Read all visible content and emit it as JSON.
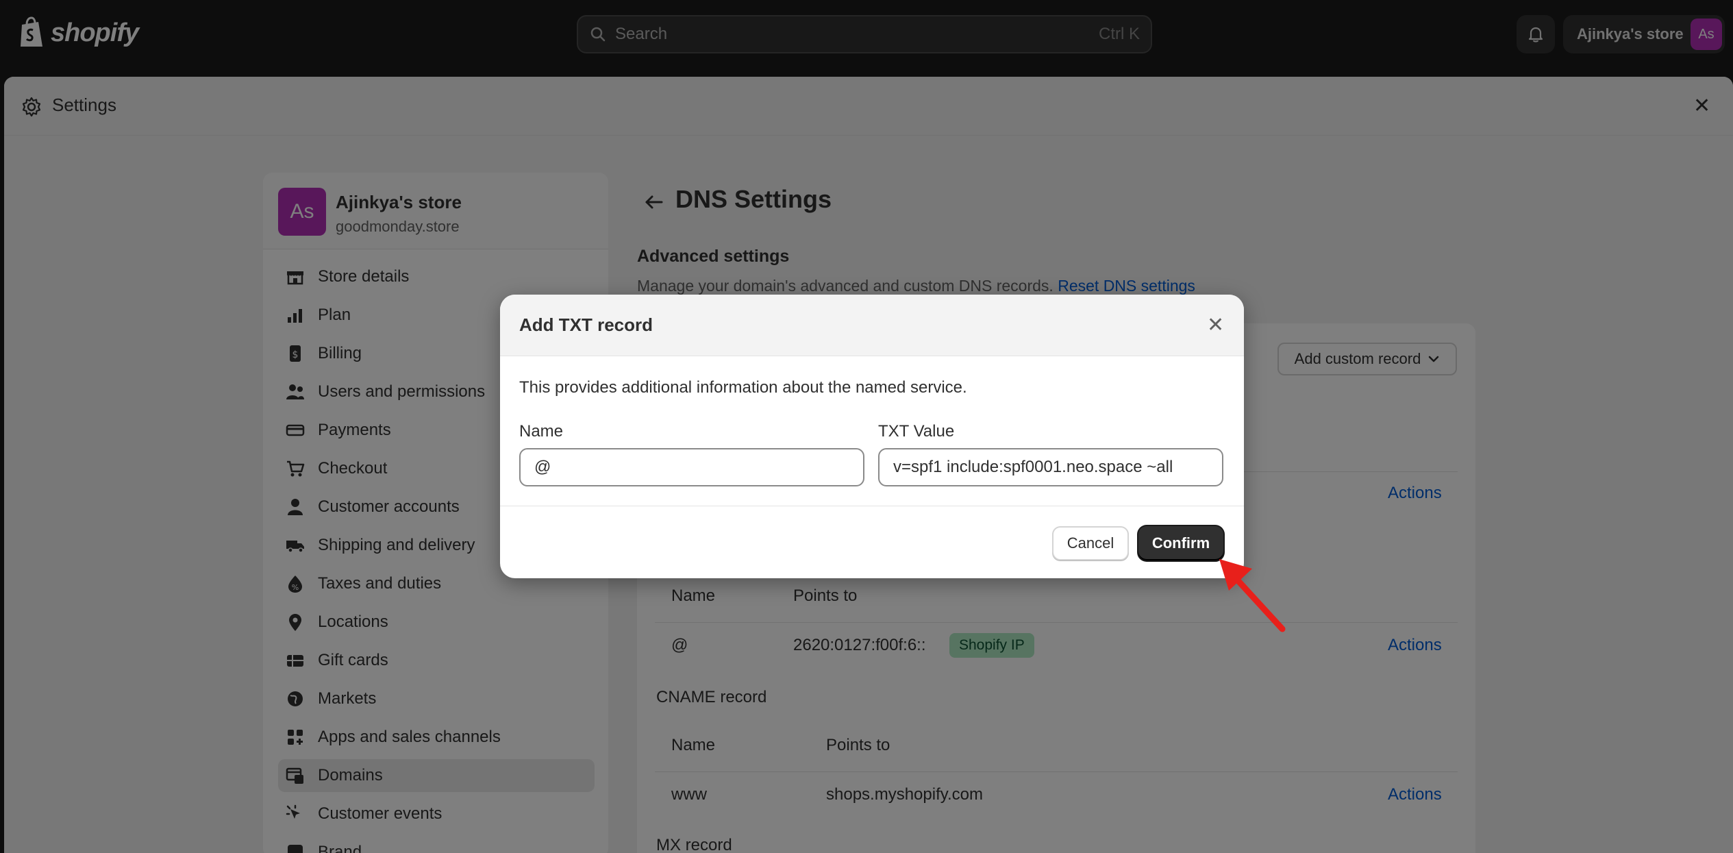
{
  "topbar": {
    "logo_text": "shopify",
    "search_placeholder": "Search",
    "search_shortcut": "Ctrl K",
    "store_button_label": "Ajinkya's store",
    "store_button_avatar": "As"
  },
  "settings": {
    "title": "Settings"
  },
  "sidebar": {
    "store_avatar": "As",
    "store_name": "Ajinkya's store",
    "store_domain": "goodmonday.store",
    "items": [
      {
        "label": "Store details",
        "icon": "store-icon"
      },
      {
        "label": "Plan",
        "icon": "plan-icon"
      },
      {
        "label": "Billing",
        "icon": "billing-icon"
      },
      {
        "label": "Users and permissions",
        "icon": "users-icon"
      },
      {
        "label": "Payments",
        "icon": "payments-icon"
      },
      {
        "label": "Checkout",
        "icon": "cart-icon"
      },
      {
        "label": "Customer accounts",
        "icon": "person-icon"
      },
      {
        "label": "Shipping and delivery",
        "icon": "truck-icon"
      },
      {
        "label": "Taxes and duties",
        "icon": "tax-icon"
      },
      {
        "label": "Locations",
        "icon": "location-icon"
      },
      {
        "label": "Gift cards",
        "icon": "gift-card-icon"
      },
      {
        "label": "Markets",
        "icon": "globe-icon"
      },
      {
        "label": "Apps and sales channels",
        "icon": "apps-icon"
      },
      {
        "label": "Domains",
        "icon": "domains-icon",
        "active": true
      },
      {
        "label": "Customer events",
        "icon": "cursor-icon"
      },
      {
        "label": "Brand",
        "icon": "brand-icon"
      }
    ]
  },
  "main": {
    "page_title": "DNS Settings",
    "advanced_title": "Advanced settings",
    "advanced_desc": "Manage your domain's advanced and custom DNS records.",
    "reset_link": "Reset DNS settings",
    "add_custom_record": "Add custom record",
    "actions_label": "Actions",
    "aaaa_table": {
      "col_name": "Name",
      "col_points_to": "Points to",
      "row_name": "@",
      "row_value": "2620:0127:f00f:6::",
      "badge": "Shopify IP"
    },
    "cname_section": "CNAME record",
    "cname_table": {
      "col_name": "Name",
      "col_points_to": "Points to",
      "row_name": "www",
      "row_value": "shops.myshopify.com"
    },
    "mx_section": "MX record"
  },
  "modal": {
    "title": "Add TXT record",
    "description": "This provides additional information about the named service.",
    "name_label": "Name",
    "name_value": "@",
    "txt_label": "TXT Value",
    "txt_value": "v=spf1 include:spf0001.neo.space ~all",
    "cancel_label": "Cancel",
    "confirm_label": "Confirm"
  },
  "colors": {
    "accent_link": "#005bd3",
    "avatar": "#b02fb5",
    "annotation_arrow": "#e8201b",
    "badge_bg": "#aee9c3"
  }
}
